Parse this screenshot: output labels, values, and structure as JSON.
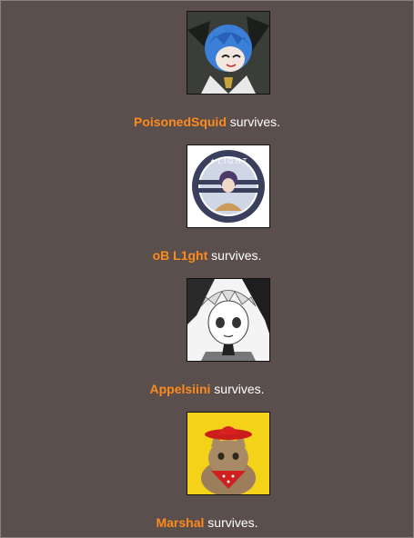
{
  "entries": [
    {
      "name": "PoisonedSquid",
      "status": " survives.",
      "avatar_icon": "anime-character-blue-hair-avatar"
    },
    {
      "name": "oB L1ght",
      "status": " survives.",
      "avatar_icon": "light-circular-logo-avatar"
    },
    {
      "name": "Appelsiini",
      "status": " survives.",
      "avatar_icon": "manga-girl-avatar"
    },
    {
      "name": "Marshal",
      "status": " survives.",
      "avatar_icon": "cat-cowboy-hat-avatar"
    }
  ],
  "colors": {
    "background": "#5a4f4c",
    "name": "#ff8a1c",
    "text": "#ffffff"
  }
}
